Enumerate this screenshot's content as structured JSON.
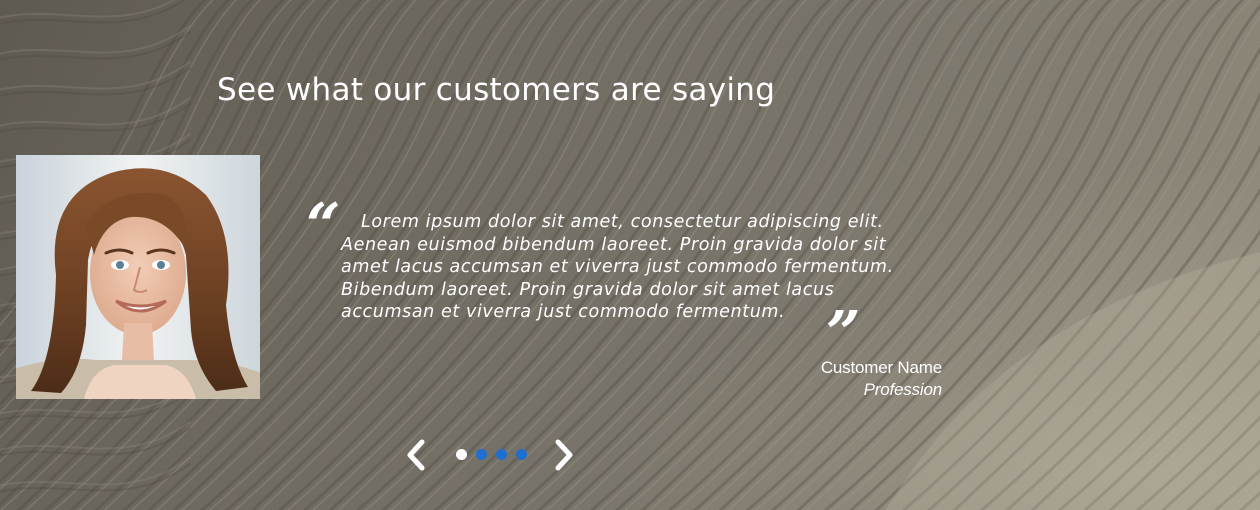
{
  "section": {
    "title": "See what our customers are saying"
  },
  "testimonial": {
    "open_quote": "“",
    "quote": "Lorem ipsum dolor sit amet, consectetur adipiscing elit. Aenean euismod bibendum laoreet. Proin gravida dolor sit amet lacus accumsan et viverra just commodo fermentum. Bibendum laoreet. Proin gravida dolor sit amet lacus accumsan et viverra just commodo fermentum.",
    "close_quote": "”",
    "customer_name": "Customer Name",
    "profession": "Profession"
  },
  "carousel": {
    "prev_icon": "chevron-left-icon",
    "next_icon": "chevron-right-icon",
    "slide_count": 4,
    "active_index": 0,
    "active_dot_color": "#ffffff",
    "inactive_dot_color": "#1f6fd0"
  }
}
